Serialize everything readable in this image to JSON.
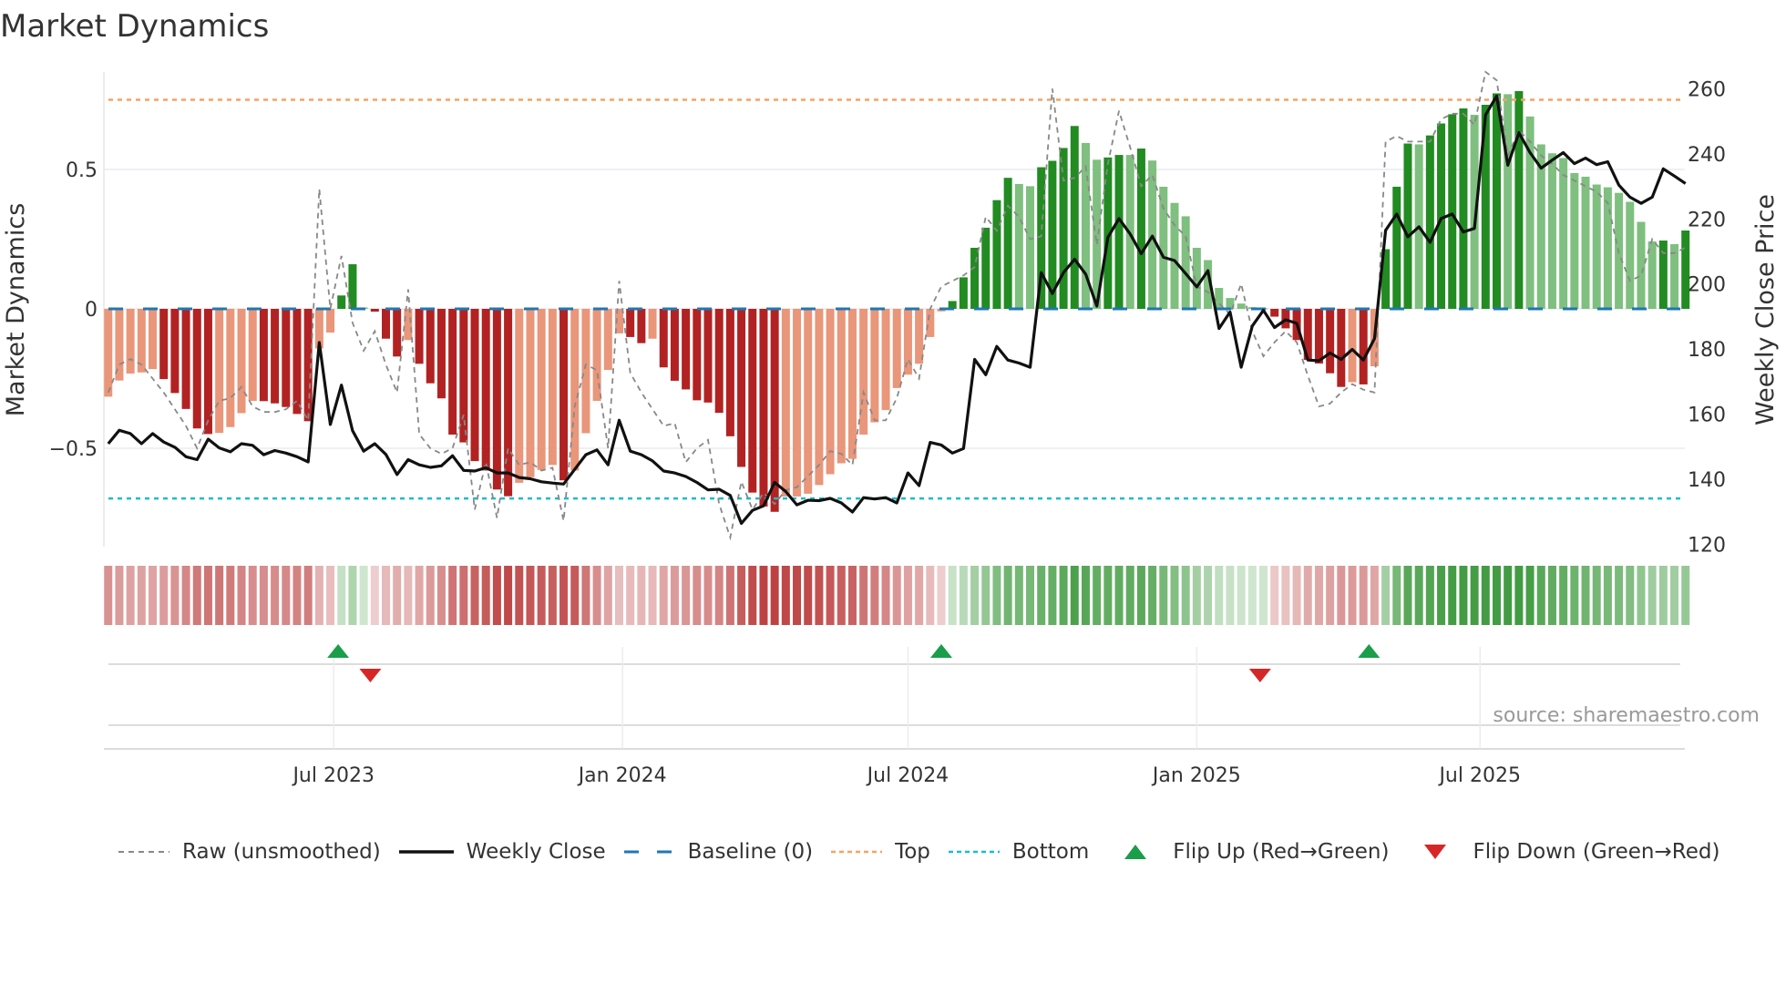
{
  "chart_data": {
    "type": "bar+line",
    "title": "Market Dynamics",
    "ylabel": "Market Dynamics",
    "y2label": "Weekly Close Price",
    "ylim": [
      -0.85,
      0.85
    ],
    "y2lim": [
      120,
      260
    ],
    "yticks": [
      {
        "v": 0.5,
        "label": "0.5"
      },
      {
        "v": 0,
        "label": "0"
      },
      {
        "v": -0.5,
        "label": "−0.5"
      }
    ],
    "y2ticks": [
      {
        "v": 120,
        "label": "120"
      },
      {
        "v": 140,
        "label": "140"
      },
      {
        "v": 160,
        "label": "160"
      },
      {
        "v": 180,
        "label": "180"
      },
      {
        "v": 200,
        "label": "200"
      },
      {
        "v": 220,
        "label": "220"
      },
      {
        "v": 240,
        "label": "240"
      },
      {
        "v": 260,
        "label": "260"
      }
    ],
    "xticks": [
      {
        "week": 20.3,
        "label": "Jul 2023"
      },
      {
        "week": 46.3,
        "label": "Jan 2024"
      },
      {
        "week": 72,
        "label": "Jul 2024"
      },
      {
        "week": 98,
        "label": "Jan 2025"
      },
      {
        "week": 123.5,
        "label": "Jul 2025"
      }
    ],
    "top_level": 0.75,
    "bottom_level": -0.68,
    "baseline": 0,
    "dynamics": [
      -0.315,
      -0.257,
      -0.232,
      -0.228,
      -0.216,
      -0.252,
      -0.302,
      -0.359,
      -0.429,
      -0.449,
      -0.445,
      -0.424,
      -0.374,
      -0.33,
      -0.331,
      -0.339,
      -0.352,
      -0.377,
      -0.403,
      -0.142,
      -0.085,
      0.048,
      0.16,
      0.005,
      -0.01,
      -0.107,
      -0.171,
      -0.112,
      -0.197,
      -0.267,
      -0.321,
      -0.451,
      -0.479,
      -0.546,
      -0.58,
      -0.648,
      -0.672,
      -0.624,
      -0.604,
      -0.578,
      -0.56,
      -0.615,
      -0.58,
      -0.446,
      -0.33,
      -0.219,
      -0.088,
      -0.101,
      -0.123,
      -0.107,
      -0.21,
      -0.258,
      -0.289,
      -0.328,
      -0.336,
      -0.373,
      -0.457,
      -0.567,
      -0.659,
      -0.709,
      -0.728,
      -0.673,
      -0.673,
      -0.663,
      -0.632,
      -0.593,
      -0.554,
      -0.538,
      -0.451,
      -0.407,
      -0.363,
      -0.284,
      -0.236,
      -0.197,
      -0.101,
      -0.009,
      0.028,
      0.113,
      0.219,
      0.291,
      0.39,
      0.47,
      0.448,
      0.44,
      0.508,
      0.531,
      0.577,
      0.656,
      0.595,
      0.535,
      0.543,
      0.552,
      0.552,
      0.575,
      0.532,
      0.438,
      0.38,
      0.332,
      0.219,
      0.175,
      0.075,
      0.039,
      0.019,
      0.006,
      0.002,
      -0.028,
      -0.07,
      -0.112,
      -0.183,
      -0.196,
      -0.231,
      -0.28,
      -0.263,
      -0.271,
      -0.206,
      0.214,
      0.438,
      0.593,
      0.59,
      0.622,
      0.665,
      0.698,
      0.719,
      0.696,
      0.732,
      0.773,
      0.77,
      0.781,
      0.69,
      0.59,
      0.558,
      0.541,
      0.487,
      0.474,
      0.446,
      0.436,
      0.416,
      0.384,
      0.312,
      0.242,
      0.245,
      0.232,
      0.281
    ],
    "raw": [
      -0.3,
      -0.2,
      -0.18,
      -0.2,
      -0.25,
      -0.3,
      -0.36,
      -0.42,
      -0.5,
      -0.4,
      -0.33,
      -0.32,
      -0.28,
      -0.35,
      -0.37,
      -0.37,
      -0.36,
      -0.33,
      -0.4,
      0.43,
      0.0,
      0.19,
      -0.05,
      -0.15,
      -0.08,
      -0.2,
      -0.3,
      0.07,
      -0.45,
      -0.5,
      -0.52,
      -0.5,
      -0.38,
      -0.72,
      -0.55,
      -0.75,
      -0.5,
      -0.56,
      -0.55,
      -0.58,
      -0.57,
      -0.76,
      -0.35,
      -0.2,
      -0.22,
      -0.5,
      0.1,
      -0.23,
      -0.3,
      -0.36,
      -0.42,
      -0.41,
      -0.55,
      -0.5,
      -0.47,
      -0.7,
      -0.82,
      -0.62,
      -0.72,
      -0.66,
      -0.7,
      -0.65,
      -0.64,
      -0.6,
      -0.56,
      -0.51,
      -0.52,
      -0.56,
      -0.3,
      -0.4,
      -0.4,
      -0.32,
      -0.18,
      -0.25,
      0.0,
      0.08,
      0.1,
      0.12,
      0.15,
      0.33,
      0.28,
      0.37,
      0.33,
      0.25,
      0.26,
      0.79,
      0.46,
      0.47,
      0.51,
      0.23,
      0.52,
      0.71,
      0.58,
      0.44,
      0.48,
      0.36,
      0.3,
      0.26,
      0.08,
      0.06,
      0.02,
      -0.02,
      0.09,
      -0.08,
      -0.17,
      -0.12,
      -0.08,
      -0.12,
      -0.24,
      -0.35,
      -0.34,
      -0.3,
      -0.27,
      -0.29,
      -0.3,
      0.6,
      0.62,
      0.6,
      0.6,
      0.6,
      0.68,
      0.7,
      0.7,
      0.66,
      0.85,
      0.82,
      0.55,
      0.64,
      0.6,
      0.55,
      0.52,
      0.48,
      0.46,
      0.44,
      0.42,
      0.38,
      0.2,
      0.1,
      0.12,
      0.25,
      0.2,
      0.2,
      0.22
    ],
    "weekly_close": [
      150.9,
      155,
      154,
      150.9,
      154,
      151.4,
      149.8,
      146.9,
      146,
      152.3,
      149.6,
      148.4,
      150.9,
      150.4,
      147.5,
      148.8,
      148,
      146.9,
      145.3,
      182,
      156.8,
      168.9,
      154.9,
      148.6,
      150.9,
      147.6,
      141.4,
      146,
      144.4,
      143.6,
      144.1,
      147.2,
      142.7,
      142.5,
      143.5,
      141.9,
      141.9,
      140.5,
      140.1,
      139.2,
      138.8,
      138.5,
      143,
      147.5,
      149,
      144.4,
      158.1,
      148.6,
      147.5,
      145.6,
      142.5,
      141.9,
      140.8,
      139,
      136.7,
      136.9,
      135,
      126.4,
      130.4,
      131.8,
      139,
      136.2,
      132.1,
      133.5,
      133.4,
      134.1,
      132.7,
      129.9,
      134.3,
      133.9,
      134.3,
      132.7,
      141.9,
      138,
      151.3,
      150.5,
      148,
      149.4,
      176.8,
      172.1,
      180.8,
      176.6,
      175.7,
      174.4,
      203.5,
      197.1,
      203.5,
      207.6,
      203,
      193.2,
      214.3,
      220.1,
      215.4,
      209.3,
      214.7,
      208.2,
      207.2,
      203.2,
      199.1,
      204.1,
      186.3,
      191.4,
      174.4,
      187.1,
      191.9,
      186.6,
      189,
      187.9,
      176.6,
      176.4,
      178.8,
      176.8,
      179.9,
      176.6,
      183.2,
      216.5,
      221.5,
      214.5,
      217.6,
      212.8,
      220.1,
      221.5,
      216,
      217.1,
      252,
      257.8,
      236.5,
      246.5,
      240.4,
      235.6,
      238.1,
      240.4,
      237,
      238.7,
      236.7,
      237.6,
      230.4,
      226.7,
      224.8,
      226.7,
      235.4,
      233.2,
      230.9
    ],
    "flips": [
      {
        "type": "up",
        "week": 20.7
      },
      {
        "type": "down",
        "week": 23.6
      },
      {
        "type": "up",
        "week": 75
      },
      {
        "type": "down",
        "week": 103.7
      },
      {
        "type": "up",
        "week": 113.5
      }
    ],
    "legend": {
      "raw": "Raw (unsmoothed)",
      "close": "Weekly Close",
      "baseline": "Baseline (0)",
      "top": "Top",
      "bottom": "Bottom",
      "flip_up": "Flip Up (Red→Green)",
      "flip_down": "Flip Down (Green→Red)"
    },
    "legend_placement": "bottom",
    "source": "source: sharemaestro.com"
  },
  "colors": {
    "neg_strong": "#b22222",
    "neg_weak": "#e9967a",
    "pos_strong": "#228b22",
    "pos_weak": "#7fbf7f",
    "top": "#f4a460",
    "bottom": "#17becf",
    "baseline": "#1f77b4",
    "flip_up": "#1a9e4a",
    "flip_down": "#d62728"
  }
}
